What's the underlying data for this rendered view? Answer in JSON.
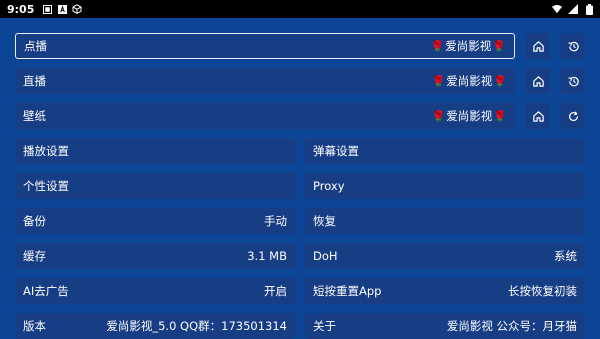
{
  "status_bar": {
    "time": "9:05"
  },
  "site_rows": [
    {
      "label": "点播",
      "site": "爱尚影视",
      "action_icon": "history-icon"
    },
    {
      "label": "直播",
      "site": "爱尚影视",
      "action_icon": "history-icon"
    },
    {
      "label": "壁纸",
      "site": "爱尚影视",
      "action_icon": "refresh-icon"
    }
  ],
  "rose_glyph": "🌹",
  "settings": {
    "playback": {
      "label": "播放设置"
    },
    "danmaku": {
      "label": "弹幕设置"
    },
    "personal": {
      "label": "个性设置"
    },
    "proxy": {
      "label": "Proxy"
    },
    "backup": {
      "label": "备份",
      "value": "手动"
    },
    "restore": {
      "label": "恢复"
    },
    "cache": {
      "label": "缓存",
      "value": "3.1 MB"
    },
    "doh": {
      "label": "DoH",
      "value": "系统"
    },
    "ai_ads": {
      "label": "AI去广告",
      "value": "开启"
    },
    "short_press": {
      "label": "短按重置App",
      "value": "长按恢复初装"
    },
    "version": {
      "label": "版本",
      "value": "爱尚影视_5.0 QQ群：173501314"
    },
    "about": {
      "label": "关于",
      "value": "爱尚影视 公众号：月牙猫"
    }
  },
  "colors": {
    "background": "#0c4496",
    "row": "#173d85",
    "selected_border": "#e8eef8",
    "rose": "#e0392b"
  }
}
